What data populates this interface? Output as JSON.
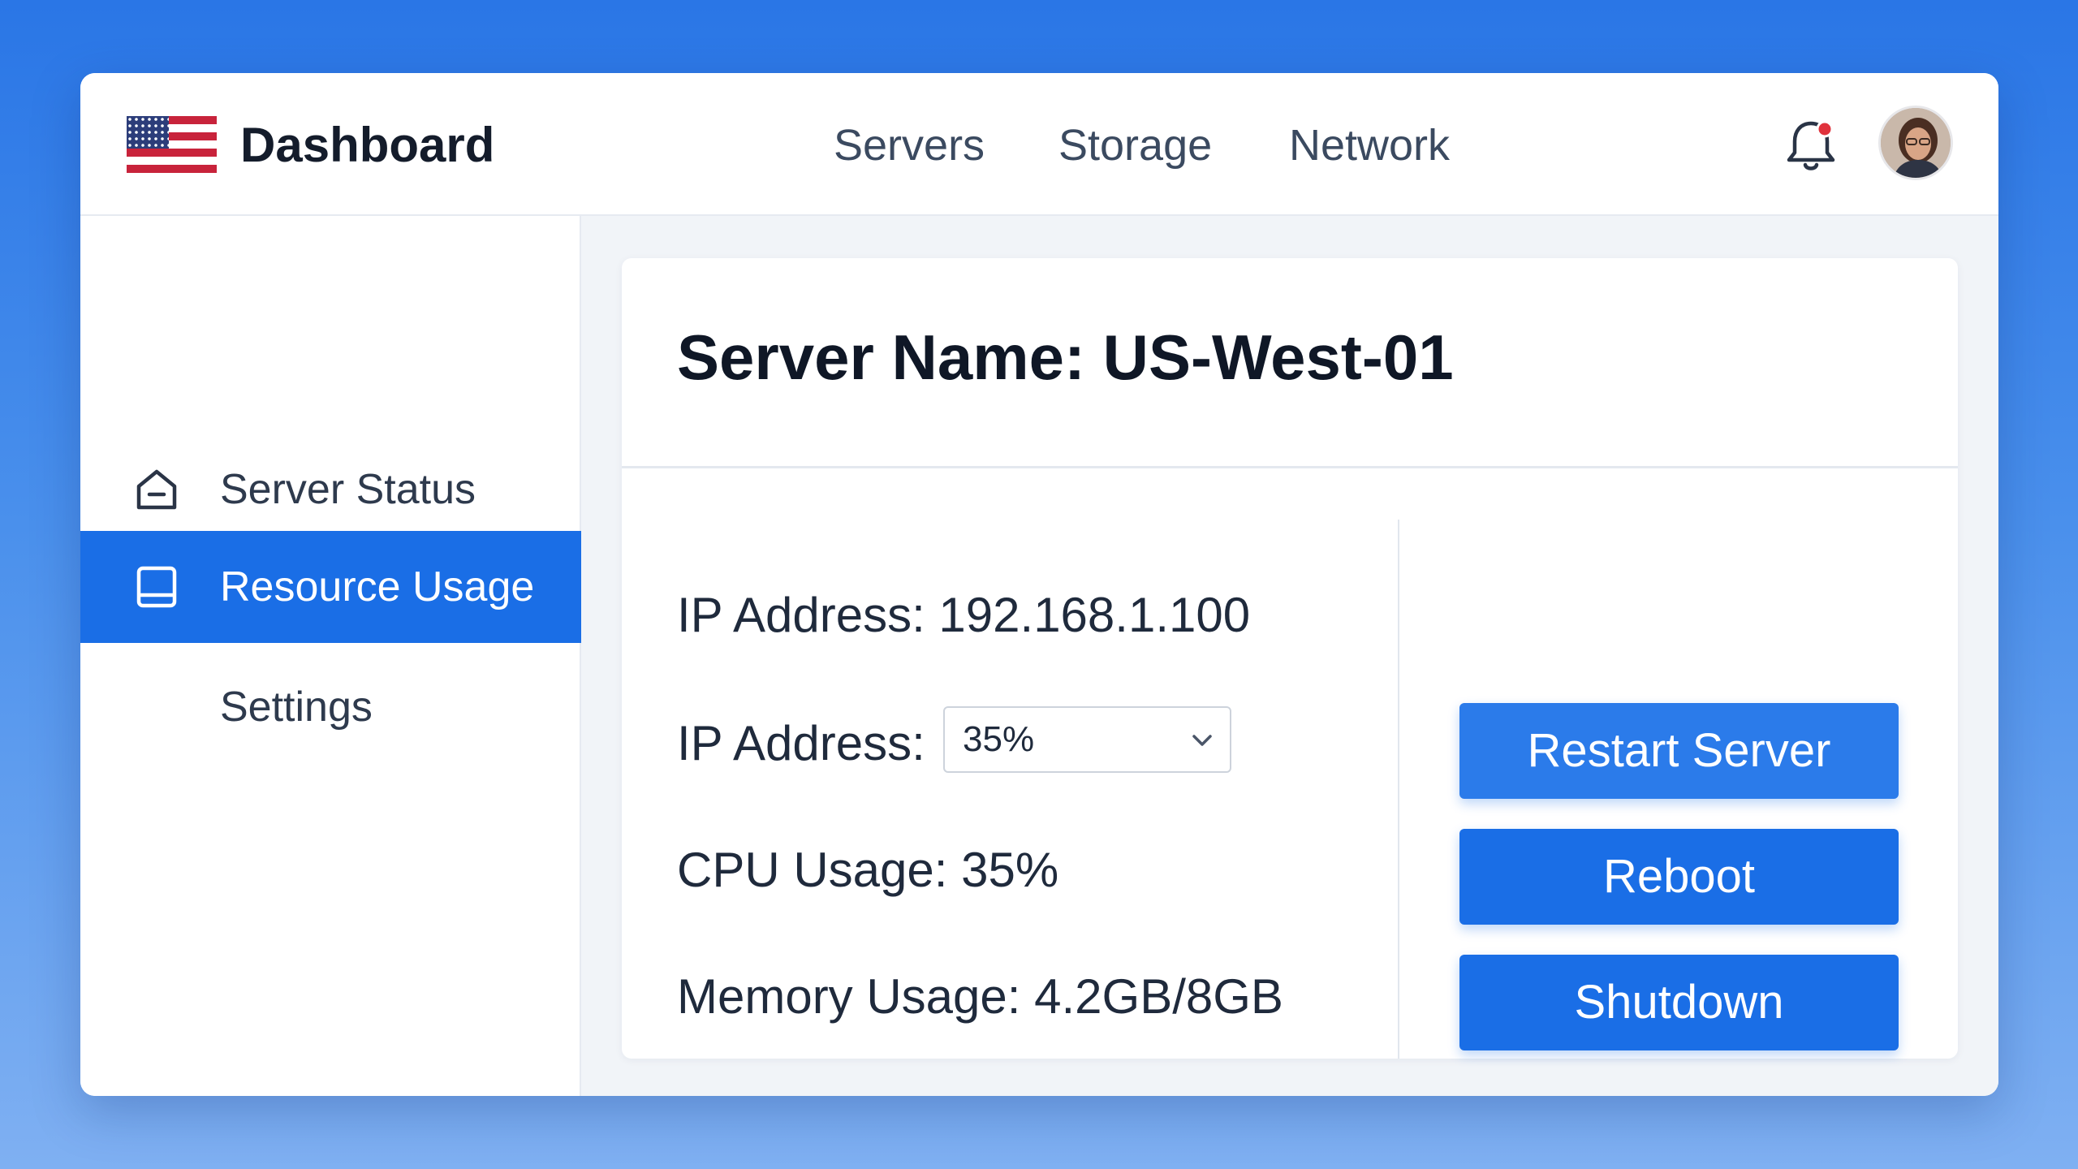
{
  "header": {
    "brand_title": "Dashboard",
    "nav": [
      {
        "label": "Servers"
      },
      {
        "label": "Storage"
      },
      {
        "label": "Network"
      }
    ],
    "notification_badge_color": "#e0323c",
    "icons": [
      "us-flag-icon",
      "bell-icon",
      "avatar"
    ]
  },
  "sidebar": {
    "items": [
      {
        "label": "Server Status",
        "icon": "home-icon",
        "active": false
      },
      {
        "label": "Resource Usage",
        "icon": "tablet-icon",
        "active": true
      },
      {
        "label": "Settings",
        "active": false
      }
    ]
  },
  "main": {
    "title": "Server Name: US-West-01",
    "info": {
      "ip_address": "IP Address: 192.168.1.100",
      "ip_address_select_label": "IP Address:",
      "ip_address_select_value": "35%",
      "cpu_usage": "CPU Usage: 35%",
      "memory_usage": "Memory Usage: 4.2GB/8GB"
    },
    "actions": {
      "restart_label": "Restart Server",
      "reboot_label": "Reboot",
      "shutdown_label": "Shutdown"
    }
  },
  "colors": {
    "accent": "#1a6ee6",
    "background_top": "#2a76e6",
    "background_bottom": "#7fb0f2",
    "text_dark": "#141c2b"
  }
}
